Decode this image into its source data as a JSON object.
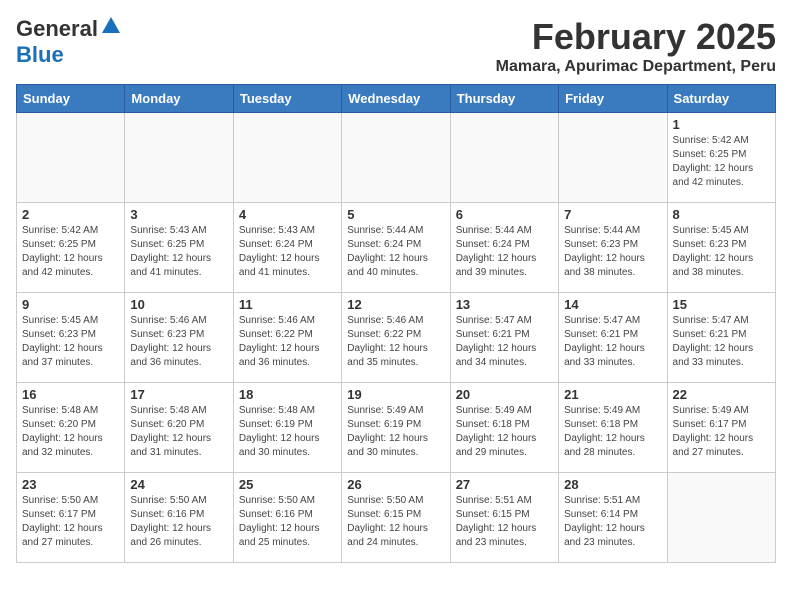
{
  "header": {
    "logo_line1": "General",
    "logo_line2": "Blue",
    "month": "February 2025",
    "location": "Mamara, Apurimac Department, Peru"
  },
  "days_of_week": [
    "Sunday",
    "Monday",
    "Tuesday",
    "Wednesday",
    "Thursday",
    "Friday",
    "Saturday"
  ],
  "weeks": [
    [
      {
        "day": "",
        "info": ""
      },
      {
        "day": "",
        "info": ""
      },
      {
        "day": "",
        "info": ""
      },
      {
        "day": "",
        "info": ""
      },
      {
        "day": "",
        "info": ""
      },
      {
        "day": "",
        "info": ""
      },
      {
        "day": "1",
        "info": "Sunrise: 5:42 AM\nSunset: 6:25 PM\nDaylight: 12 hours and 42 minutes."
      }
    ],
    [
      {
        "day": "2",
        "info": "Sunrise: 5:42 AM\nSunset: 6:25 PM\nDaylight: 12 hours and 42 minutes."
      },
      {
        "day": "3",
        "info": "Sunrise: 5:43 AM\nSunset: 6:25 PM\nDaylight: 12 hours and 41 minutes."
      },
      {
        "day": "4",
        "info": "Sunrise: 5:43 AM\nSunset: 6:24 PM\nDaylight: 12 hours and 41 minutes."
      },
      {
        "day": "5",
        "info": "Sunrise: 5:44 AM\nSunset: 6:24 PM\nDaylight: 12 hours and 40 minutes."
      },
      {
        "day": "6",
        "info": "Sunrise: 5:44 AM\nSunset: 6:24 PM\nDaylight: 12 hours and 39 minutes."
      },
      {
        "day": "7",
        "info": "Sunrise: 5:44 AM\nSunset: 6:23 PM\nDaylight: 12 hours and 38 minutes."
      },
      {
        "day": "8",
        "info": "Sunrise: 5:45 AM\nSunset: 6:23 PM\nDaylight: 12 hours and 38 minutes."
      }
    ],
    [
      {
        "day": "9",
        "info": "Sunrise: 5:45 AM\nSunset: 6:23 PM\nDaylight: 12 hours and 37 minutes."
      },
      {
        "day": "10",
        "info": "Sunrise: 5:46 AM\nSunset: 6:23 PM\nDaylight: 12 hours and 36 minutes."
      },
      {
        "day": "11",
        "info": "Sunrise: 5:46 AM\nSunset: 6:22 PM\nDaylight: 12 hours and 36 minutes."
      },
      {
        "day": "12",
        "info": "Sunrise: 5:46 AM\nSunset: 6:22 PM\nDaylight: 12 hours and 35 minutes."
      },
      {
        "day": "13",
        "info": "Sunrise: 5:47 AM\nSunset: 6:21 PM\nDaylight: 12 hours and 34 minutes."
      },
      {
        "day": "14",
        "info": "Sunrise: 5:47 AM\nSunset: 6:21 PM\nDaylight: 12 hours and 33 minutes."
      },
      {
        "day": "15",
        "info": "Sunrise: 5:47 AM\nSunset: 6:21 PM\nDaylight: 12 hours and 33 minutes."
      }
    ],
    [
      {
        "day": "16",
        "info": "Sunrise: 5:48 AM\nSunset: 6:20 PM\nDaylight: 12 hours and 32 minutes."
      },
      {
        "day": "17",
        "info": "Sunrise: 5:48 AM\nSunset: 6:20 PM\nDaylight: 12 hours and 31 minutes."
      },
      {
        "day": "18",
        "info": "Sunrise: 5:48 AM\nSunset: 6:19 PM\nDaylight: 12 hours and 30 minutes."
      },
      {
        "day": "19",
        "info": "Sunrise: 5:49 AM\nSunset: 6:19 PM\nDaylight: 12 hours and 30 minutes."
      },
      {
        "day": "20",
        "info": "Sunrise: 5:49 AM\nSunset: 6:18 PM\nDaylight: 12 hours and 29 minutes."
      },
      {
        "day": "21",
        "info": "Sunrise: 5:49 AM\nSunset: 6:18 PM\nDaylight: 12 hours and 28 minutes."
      },
      {
        "day": "22",
        "info": "Sunrise: 5:49 AM\nSunset: 6:17 PM\nDaylight: 12 hours and 27 minutes."
      }
    ],
    [
      {
        "day": "23",
        "info": "Sunrise: 5:50 AM\nSunset: 6:17 PM\nDaylight: 12 hours and 27 minutes."
      },
      {
        "day": "24",
        "info": "Sunrise: 5:50 AM\nSunset: 6:16 PM\nDaylight: 12 hours and 26 minutes."
      },
      {
        "day": "25",
        "info": "Sunrise: 5:50 AM\nSunset: 6:16 PM\nDaylight: 12 hours and 25 minutes."
      },
      {
        "day": "26",
        "info": "Sunrise: 5:50 AM\nSunset: 6:15 PM\nDaylight: 12 hours and 24 minutes."
      },
      {
        "day": "27",
        "info": "Sunrise: 5:51 AM\nSunset: 6:15 PM\nDaylight: 12 hours and 23 minutes."
      },
      {
        "day": "28",
        "info": "Sunrise: 5:51 AM\nSunset: 6:14 PM\nDaylight: 12 hours and 23 minutes."
      },
      {
        "day": "",
        "info": ""
      }
    ]
  ]
}
